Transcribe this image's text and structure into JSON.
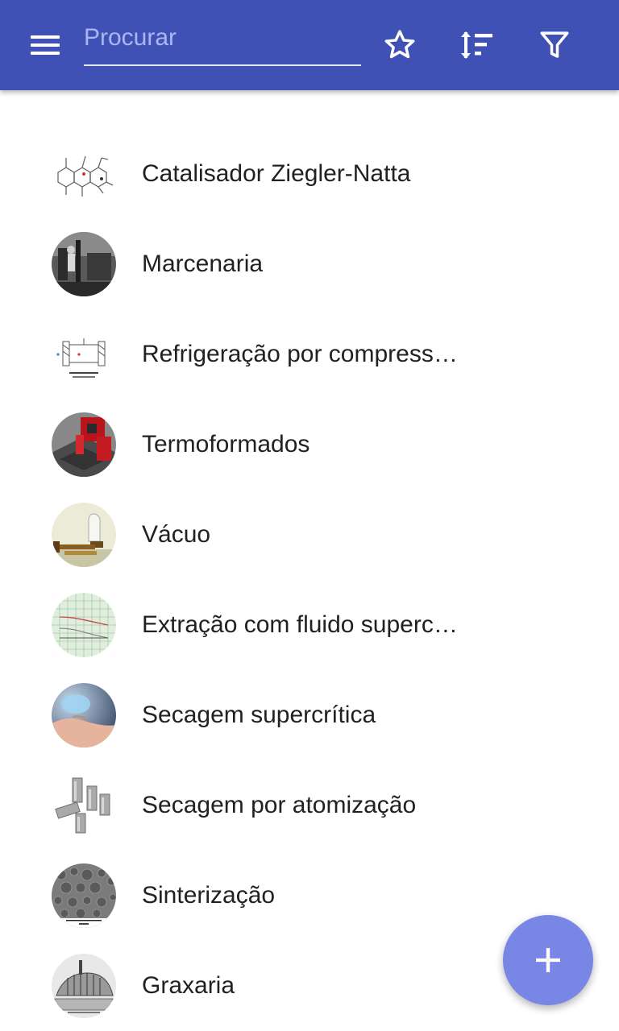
{
  "appbar": {
    "menu_icon": "menu-icon",
    "search": {
      "placeholder": "Procurar",
      "value": ""
    },
    "actions": [
      {
        "name": "favorites",
        "icon": "star-outline-icon"
      },
      {
        "name": "sort",
        "icon": "sort-icon"
      },
      {
        "name": "filter",
        "icon": "filter-icon"
      }
    ],
    "color": "#3f51b5"
  },
  "list": {
    "items": [
      {
        "label": "Catalisador Ziegler-Natta",
        "thumb": "chemical-structure"
      },
      {
        "label": "Marcenaria",
        "thumb": "workshop-photo"
      },
      {
        "label": "Refrigeração por compress…",
        "thumb": "refrigeration-diagram"
      },
      {
        "label": "Termoformados",
        "thumb": "thermoforming-machine"
      },
      {
        "label": "Vácuo",
        "thumb": "vacuum-apparatus"
      },
      {
        "label": "Extração com fluido superc…",
        "thumb": "phase-chart"
      },
      {
        "label": "Secagem supercrítica",
        "thumb": "aerogel-hand"
      },
      {
        "label": "Secagem por atomização",
        "thumb": "atomizer-nozzles"
      },
      {
        "label": "Sinterização",
        "thumb": "sinter-pellets"
      },
      {
        "label": "Graxaria",
        "thumb": "rendering-plant-drawing"
      }
    ]
  },
  "fab": {
    "icon": "plus-icon",
    "color": "#7986e6"
  }
}
